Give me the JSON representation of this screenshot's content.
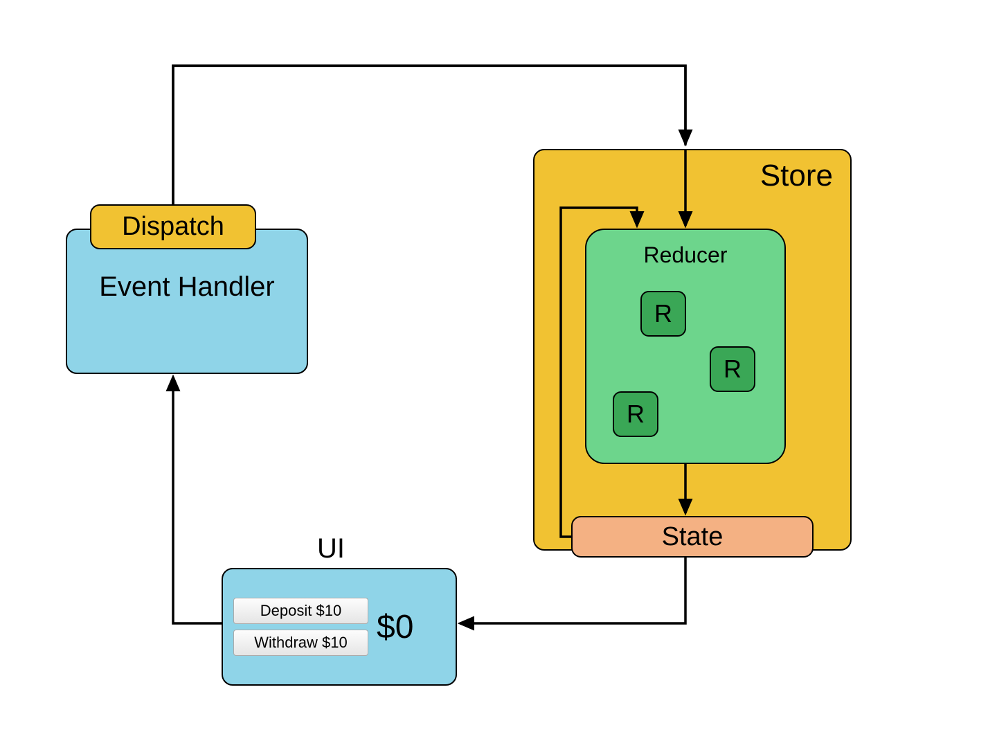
{
  "store": {
    "label": "Store"
  },
  "reducer": {
    "label": "Reducer",
    "chips": [
      "R",
      "R",
      "R"
    ]
  },
  "state": {
    "label": "State"
  },
  "dispatch": {
    "label": "Dispatch"
  },
  "eventHandler": {
    "label": "Event Handler"
  },
  "ui": {
    "label": "UI",
    "depositLabel": "Deposit $10",
    "withdrawLabel": "Withdraw $10",
    "amount": "$0"
  }
}
